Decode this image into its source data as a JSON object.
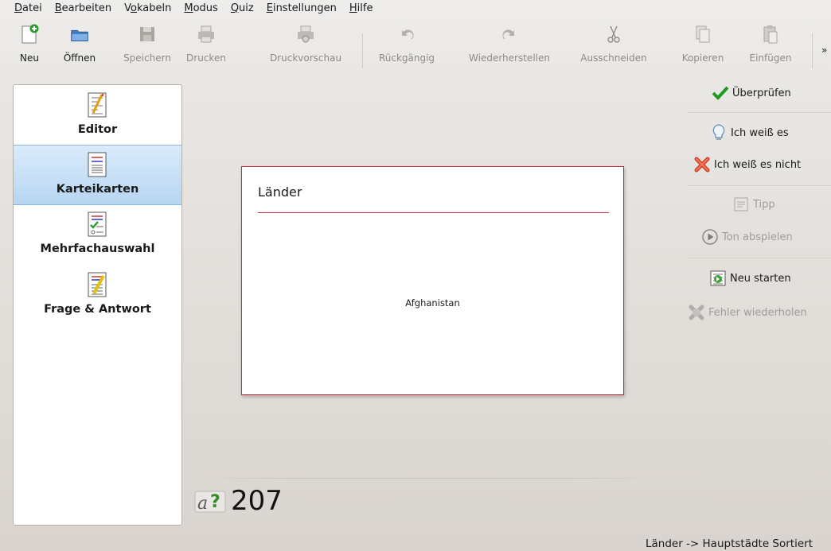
{
  "menubar": {
    "items": [
      {
        "pre": "",
        "u": "D",
        "post": "atei"
      },
      {
        "pre": "",
        "u": "B",
        "post": "earbeiten"
      },
      {
        "pre": "V",
        "u": "o",
        "post": "kabeln"
      },
      {
        "pre": "",
        "u": "M",
        "post": "odus"
      },
      {
        "pre": "",
        "u": "Q",
        "post": "uiz"
      },
      {
        "pre": "",
        "u": "E",
        "post": "instellungen"
      },
      {
        "pre": "",
        "u": "H",
        "post": "ilfe"
      }
    ]
  },
  "toolbar": {
    "new": "Neu",
    "open": "Öffnen",
    "save": "Speichern",
    "print": "Drucken",
    "print_preview": "Druckvorschau",
    "undo": "Rückgängig",
    "redo": "Wiederherstellen",
    "cut": "Ausschneiden",
    "copy": "Kopieren",
    "paste": "Einfügen",
    "overflow": "»"
  },
  "sidebar": {
    "modes": [
      {
        "label": "Editor",
        "selected": false
      },
      {
        "label": "Karteikarten",
        "selected": true
      },
      {
        "label": "Mehrfachauswahl",
        "selected": false
      },
      {
        "label": "Frage & Antwort",
        "selected": false
      }
    ]
  },
  "card": {
    "title": "Länder",
    "word": "Afghanistan"
  },
  "actions": {
    "check": "Überprüfen",
    "know": "Ich weiß es",
    "dont_know": "Ich weiß es nicht",
    "hint": "Tipp",
    "play_sound": "Ton abspielen",
    "restart": "Neu starten",
    "repeat_errors": "Fehler wiederholen"
  },
  "counter": {
    "value": "207"
  },
  "status": {
    "text": "Länder -> Hauptstädte Sortiert"
  },
  "colors": {
    "accent_red": "#c8323b",
    "selection_blue": "#b7d6f2",
    "check_green": "#1e9a1e"
  }
}
